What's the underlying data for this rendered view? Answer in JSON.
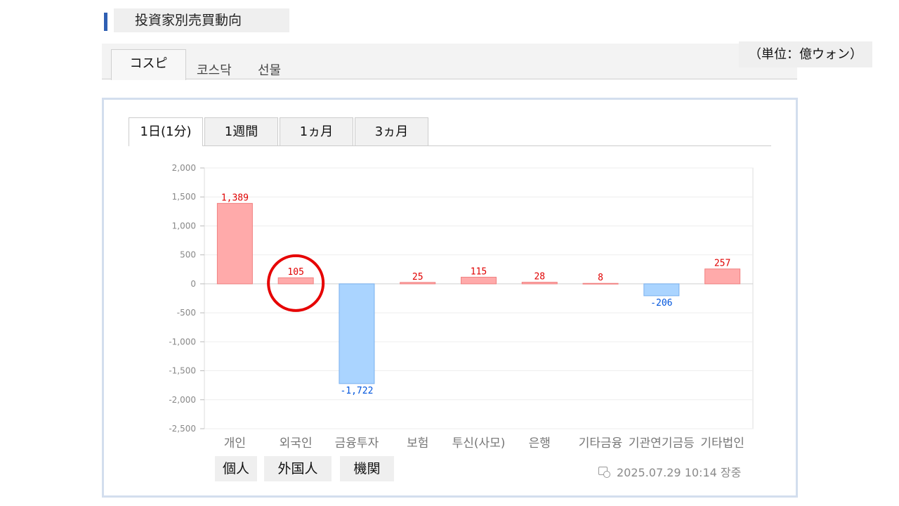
{
  "header": {
    "title": "投資家別売買動向"
  },
  "market_tabs": [
    "コスピ",
    "코스닥",
    "선물"
  ],
  "unit_label": "（単位：億ウォン）",
  "period_tabs": [
    "1日(1分)",
    "1週間",
    "1ヵ月",
    "3ヵ月"
  ],
  "annotation_labels": [
    "個人",
    "外国人",
    "機関"
  ],
  "timestamp": "2025.07.29 10:14 장중",
  "colors": {
    "positive_fill": "#ffaaaa",
    "positive_stroke": "#f08080",
    "positive_text": "#e00000",
    "negative_fill": "#aad4ff",
    "negative_stroke": "#7ab0ee",
    "negative_text": "#0055dd",
    "highlight": "#e60000"
  },
  "chart_data": {
    "type": "bar",
    "categories": [
      "개인",
      "외국인",
      "금융투자",
      "보험",
      "투신(사모)",
      "은행",
      "기타금융",
      "기관연기금등",
      "기타법인"
    ],
    "values": [
      1389,
      105,
      -1722,
      25,
      115,
      28,
      8,
      -206,
      257
    ],
    "data_labels": [
      "1,389",
      "105",
      "-1,722",
      "25",
      "115",
      "28",
      "8",
      "-206",
      "257"
    ],
    "ylim": [
      -2500,
      2000
    ],
    "yticks": [
      2000,
      1500,
      1000,
      500,
      0,
      -500,
      -1000,
      -1500,
      -2000,
      -2500
    ],
    "ytick_labels": [
      "2,000",
      "1,500",
      "1,000",
      "500",
      "0",
      "-500",
      "-1,000",
      "-1,500",
      "-2,000",
      "-2,500"
    ],
    "grid": true,
    "highlighted_category": "외국인"
  }
}
